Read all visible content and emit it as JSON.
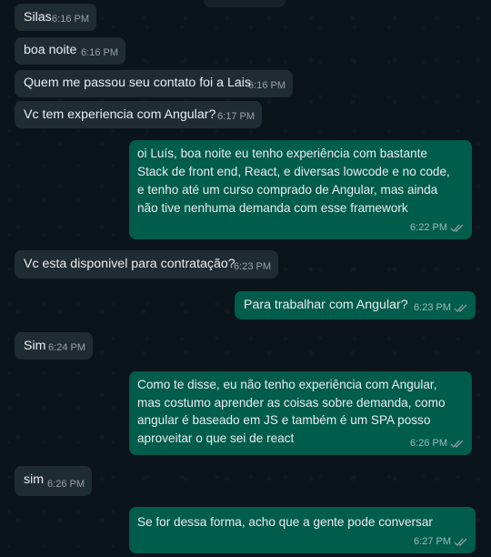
{
  "messages": [
    {
      "text": "Silas",
      "time": "6:16 PM"
    },
    {
      "text": "boa noite",
      "time": "6:16 PM"
    },
    {
      "text": "Quem me passou seu contato foi a Lais",
      "time": "6:16 PM"
    },
    {
      "text": "Vc tem experiencia com Angular?",
      "time": "6:17 PM"
    },
    {
      "lines": [
        "oi Luís, boa noite eu tenho experiência com bastante",
        "Stack de front end, React, e diversas lowcode e no code,",
        "e tenho até um curso comprado de Angular, mas ainda",
        "não tive nenhuma demanda com esse framework"
      ],
      "time": "6:22 PM",
      "read_receipt": "double-check-icon"
    },
    {
      "text": "Vc esta disponivel para contratação?",
      "time": "6:23 PM"
    },
    {
      "text": "Para trabalhar com Angular?",
      "time": "6:23 PM",
      "read_receipt": "double-check-icon"
    },
    {
      "text": "Sim",
      "time": "6:24 PM"
    },
    {
      "lines": [
        "Como te disse, eu não tenho experiência com Angular,",
        "mas costumo aprender as coisas sobre demanda, como",
        "angular é baseado em JS e também é um SPA posso",
        "aproveitar o que sei de react"
      ],
      "time": "6:26 PM",
      "read_receipt": "double-check-icon"
    },
    {
      "text": "sim",
      "time": "6:26 PM"
    },
    {
      "text": "Se for dessa forma, acho que a gente pode conversar",
      "time": "6:27 PM",
      "read_receipt": "double-check-icon"
    }
  ],
  "colors": {
    "background": "#0b141a",
    "incoming_bubble": "#202c33",
    "outgoing_bubble": "#005c4b",
    "text": "#e9edef"
  }
}
